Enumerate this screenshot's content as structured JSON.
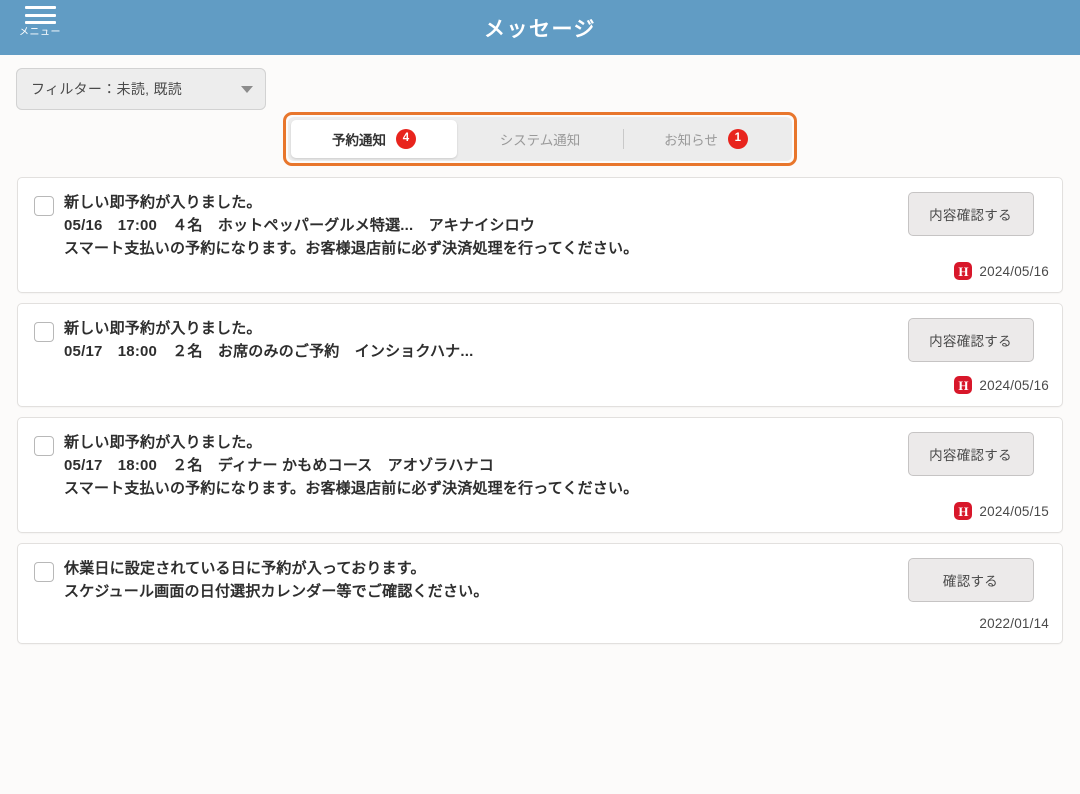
{
  "header": {
    "title": "メッセージ",
    "menu_label": "メニュー",
    "menu_icon": "hamburger-icon",
    "background_color": "#619cc4"
  },
  "filter": {
    "label": "フィルター：未読, 既読",
    "caret_icon": "chevron-down-icon"
  },
  "tabs": {
    "focus_color": "#e8762c",
    "badge_color": "#e8241d",
    "items": [
      {
        "label": "予約通知",
        "badge": "4",
        "active": true
      },
      {
        "label": "システム通知",
        "badge": "",
        "active": false
      },
      {
        "label": "お知らせ",
        "badge": "1",
        "active": false
      }
    ]
  },
  "messages": [
    {
      "lines": [
        "新しい即予約が入りました。",
        "05/16　17:00　４名　ホットペッパーグルメ特選...　アキナイシロウ",
        "スマート支払いの予約になります。お客様退店前に必ず決済処理を行ってください。"
      ],
      "button_label": "内容確認する",
      "date": "2024/05/16",
      "source_icon": "H",
      "has_source_icon": true,
      "checked": false
    },
    {
      "lines": [
        "新しい即予約が入りました。",
        "05/17　18:00　２名　お席のみのご予約　インショクハナ..."
      ],
      "button_label": "内容確認する",
      "date": "2024/05/16",
      "source_icon": "H",
      "has_source_icon": true,
      "checked": false
    },
    {
      "lines": [
        "新しい即予約が入りました。",
        "05/17　18:00　２名　ディナー かもめコース　アオゾラハナコ",
        "スマート支払いの予約になります。お客様退店前に必ず決済処理を行ってください。"
      ],
      "button_label": "内容確認する",
      "date": "2024/05/15",
      "source_icon": "H",
      "has_source_icon": true,
      "checked": false
    },
    {
      "lines": [
        "休業日に設定されている日に予約が入っております。",
        "スケジュール画面の日付選択カレンダー等でご確認ください。"
      ],
      "button_label": "確認する",
      "date": "2022/01/14",
      "source_icon": "",
      "has_source_icon": false,
      "checked": false
    }
  ]
}
